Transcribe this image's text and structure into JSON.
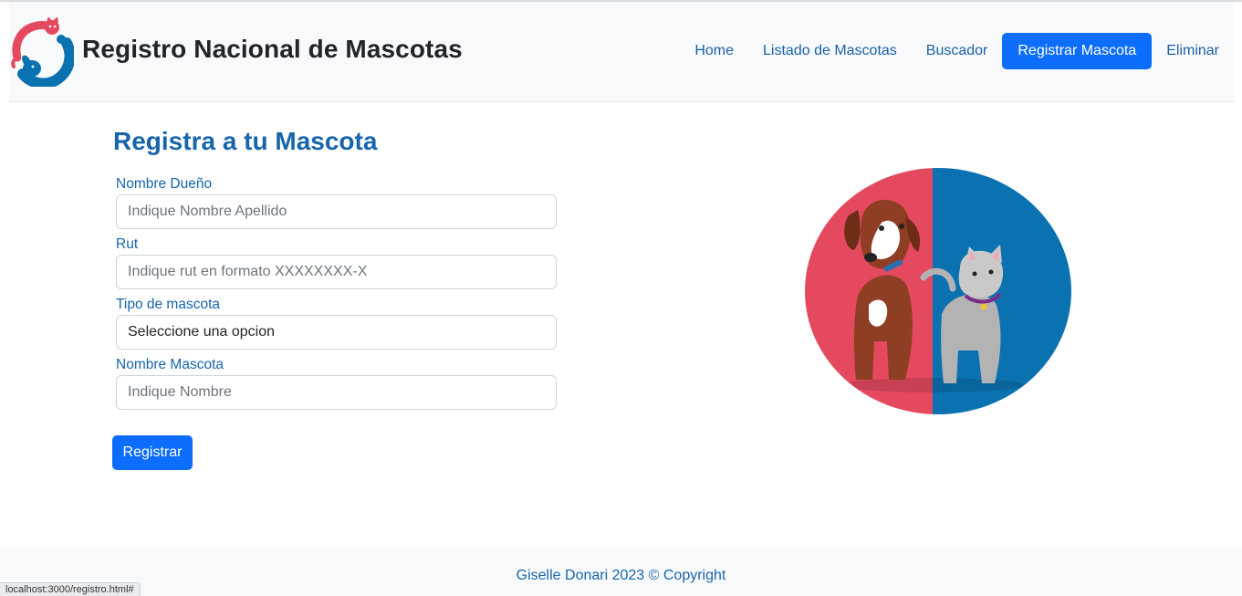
{
  "header": {
    "brand": "Registro Nacional de Mascotas",
    "logo_icon": "cat-dog-logo-icon",
    "nav": [
      {
        "label": "Home",
        "active": false
      },
      {
        "label": "Listado de Mascotas",
        "active": false
      },
      {
        "label": "Buscador",
        "active": false
      },
      {
        "label": "Registrar Mascota",
        "active": true
      },
      {
        "label": "Eliminar",
        "active": false
      }
    ]
  },
  "form": {
    "title": "Registra a tu Mascota",
    "owner_name": {
      "label": "Nombre Dueño",
      "placeholder": "Indique Nombre Apellido",
      "value": ""
    },
    "rut": {
      "label": "Rut",
      "placeholder": "Indique rut en formato XXXXXXXX-X",
      "value": ""
    },
    "pet_type": {
      "label": "Tipo de mascota",
      "selected": "Seleccione una opcion"
    },
    "pet_name": {
      "label": "Nombre Mascota",
      "placeholder": "Indique Nombre",
      "value": ""
    },
    "submit_label": "Registrar"
  },
  "illustration": {
    "icon": "dog-and-cat-illustration",
    "left_color": "#e4495f",
    "right_color": "#0b72b1"
  },
  "footer": {
    "text": "Giselle Donari 2023 © Copyright"
  },
  "status_bar": {
    "url": "localhost:3000/registro.html#"
  },
  "colors": {
    "primary": "#0d6efd",
    "link": "#1765ac",
    "navbar_bg": "#f8f9fa"
  }
}
